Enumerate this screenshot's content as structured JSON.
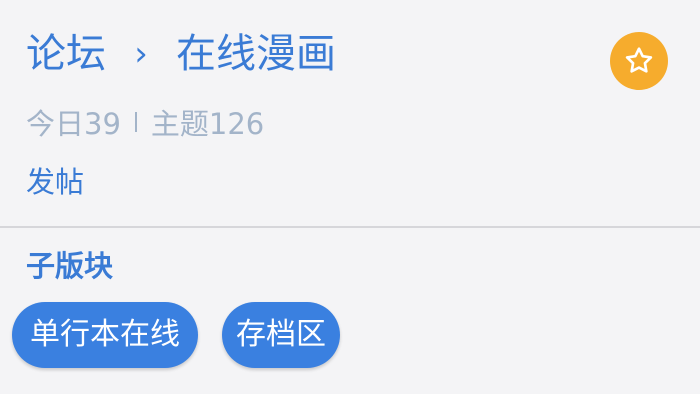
{
  "breadcrumb": {
    "root": "论坛",
    "separator": "›",
    "current": "在线漫画"
  },
  "favorite": {
    "icon": "star-icon",
    "color": "#f6ac2d"
  },
  "stats": {
    "today_label": "今日39",
    "topics_label": "主题126"
  },
  "actions": {
    "post": "发帖"
  },
  "subforums": {
    "title": "子版块",
    "items": [
      {
        "label": "单行本在线"
      },
      {
        "label": "存档区"
      }
    ]
  },
  "colors": {
    "accent": "#3a7bd5",
    "chip": "#3a80e0",
    "muted": "#a3b4c9",
    "star_badge": "#f6ac2d",
    "background": "#f4f4f6"
  }
}
